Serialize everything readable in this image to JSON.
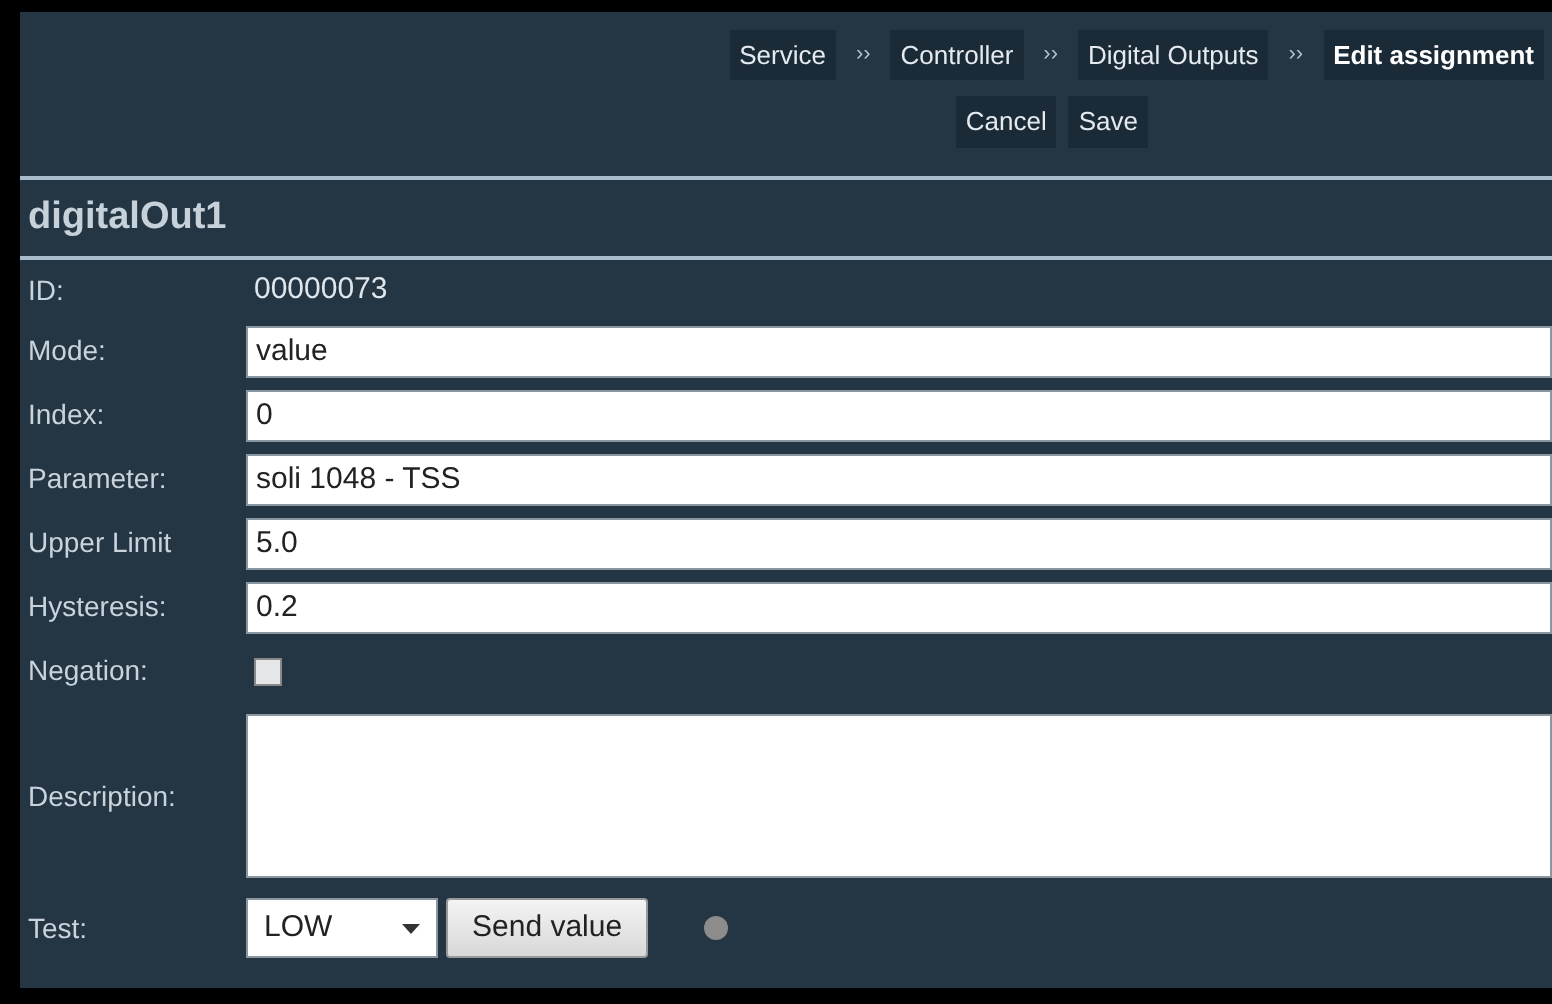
{
  "breadcrumb": [
    {
      "label": "Service",
      "separator": "››",
      "current": false
    },
    {
      "label": "Controller",
      "separator": "››",
      "current": false
    },
    {
      "label": "Digital Outputs",
      "separator": "››",
      "current": false
    },
    {
      "label": "Edit assignment",
      "current": true
    }
  ],
  "actions": [
    "Cancel",
    "Save"
  ],
  "title": "digitalOut1",
  "fields": [
    {
      "kind": "text",
      "label": "ID:",
      "value": "00000073"
    },
    {
      "kind": "input",
      "label": "Mode:",
      "value": "value"
    },
    {
      "kind": "input",
      "label": "Index:",
      "value": "0"
    },
    {
      "kind": "input",
      "label": "Parameter:",
      "value": "soli 1048 - TSS"
    },
    {
      "kind": "input",
      "label": "Upper Limit",
      "value": "5.0"
    },
    {
      "kind": "input",
      "label": "Hysteresis:",
      "value": "0.2"
    },
    {
      "kind": "checkbox",
      "label": "Negation:",
      "checked": false
    },
    {
      "kind": "textarea",
      "label": "Description:"
    },
    {
      "kind": "test",
      "label": "Test:",
      "value": "LOW",
      "button": "Send value",
      "on": false
    }
  ]
}
